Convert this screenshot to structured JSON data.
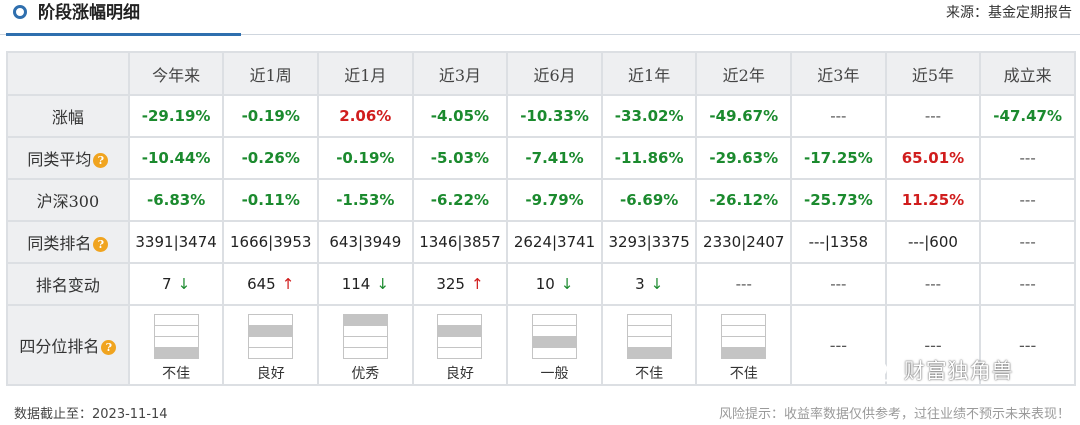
{
  "header": {
    "title": "阶段涨幅明细",
    "source": "来源：基金定期报告",
    "accent_color": "#2f6fae"
  },
  "table": {
    "columns": [
      "今年来",
      "近1周",
      "近1月",
      "近3月",
      "近6月",
      "近1年",
      "近2年",
      "近3年",
      "近5年",
      "成立来"
    ],
    "rows": [
      {
        "label": "涨幅",
        "has_help": false,
        "cells": [
          {
            "text": "-29.19%",
            "tone": "neg"
          },
          {
            "text": "-0.19%",
            "tone": "neg"
          },
          {
            "text": "2.06%",
            "tone": "pos"
          },
          {
            "text": "-4.05%",
            "tone": "neg"
          },
          {
            "text": "-10.33%",
            "tone": "neg"
          },
          {
            "text": "-33.02%",
            "tone": "neg"
          },
          {
            "text": "-49.67%",
            "tone": "neg"
          },
          {
            "text": "---",
            "tone": "dash"
          },
          {
            "text": "---",
            "tone": "dash"
          },
          {
            "text": "-47.47%",
            "tone": "neg"
          }
        ]
      },
      {
        "label": "同类平均",
        "has_help": true,
        "cells": [
          {
            "text": "-10.44%",
            "tone": "neg"
          },
          {
            "text": "-0.26%",
            "tone": "neg"
          },
          {
            "text": "-0.19%",
            "tone": "neg"
          },
          {
            "text": "-5.03%",
            "tone": "neg"
          },
          {
            "text": "-7.41%",
            "tone": "neg"
          },
          {
            "text": "-11.86%",
            "tone": "neg"
          },
          {
            "text": "-29.63%",
            "tone": "neg"
          },
          {
            "text": "-17.25%",
            "tone": "neg"
          },
          {
            "text": "65.01%",
            "tone": "pos"
          },
          {
            "text": "---",
            "tone": "dash"
          }
        ]
      },
      {
        "label": "沪深300",
        "has_help": false,
        "cells": [
          {
            "text": "-6.83%",
            "tone": "neg"
          },
          {
            "text": "-0.11%",
            "tone": "neg"
          },
          {
            "text": "-1.53%",
            "tone": "neg"
          },
          {
            "text": "-6.22%",
            "tone": "neg"
          },
          {
            "text": "-9.79%",
            "tone": "neg"
          },
          {
            "text": "-6.69%",
            "tone": "neg"
          },
          {
            "text": "-26.12%",
            "tone": "neg"
          },
          {
            "text": "-25.73%",
            "tone": "neg"
          },
          {
            "text": "11.25%",
            "tone": "pos"
          },
          {
            "text": "---",
            "tone": "dash"
          }
        ]
      },
      {
        "label": "同类排名",
        "has_help": true,
        "cells": [
          {
            "text": "3391|3474",
            "tone": "plain"
          },
          {
            "text": "1666|3953",
            "tone": "plain"
          },
          {
            "text": "643|3949",
            "tone": "plain"
          },
          {
            "text": "1346|3857",
            "tone": "plain"
          },
          {
            "text": "2624|3741",
            "tone": "plain"
          },
          {
            "text": "3293|3375",
            "tone": "plain"
          },
          {
            "text": "2330|2407",
            "tone": "plain"
          },
          {
            "text": "---|1358",
            "tone": "plain"
          },
          {
            "text": "---|600",
            "tone": "plain"
          },
          {
            "text": "---",
            "tone": "dash"
          }
        ]
      },
      {
        "label": "排名变动",
        "has_help": false,
        "cells": [
          {
            "text": "7",
            "dir": "down"
          },
          {
            "text": "645",
            "dir": "up"
          },
          {
            "text": "114",
            "dir": "down"
          },
          {
            "text": "325",
            "dir": "up"
          },
          {
            "text": "10",
            "dir": "down"
          },
          {
            "text": "3",
            "dir": "down"
          },
          {
            "text": "---",
            "dir": "none"
          },
          {
            "text": "---",
            "dir": "none"
          },
          {
            "text": "---",
            "dir": "none"
          },
          {
            "text": "---",
            "dir": "none"
          }
        ]
      }
    ],
    "quartile_row": {
      "label": "四分位排名",
      "has_help": true,
      "cells": [
        {
          "label": "不佳",
          "quartile": 4
        },
        {
          "label": "良好",
          "quartile": 2
        },
        {
          "label": "优秀",
          "quartile": 1
        },
        {
          "label": "良好",
          "quartile": 2
        },
        {
          "label": "一般",
          "quartile": 3
        },
        {
          "label": "不佳",
          "quartile": 4
        },
        {
          "label": "不佳",
          "quartile": 4
        },
        {
          "label": "---",
          "quartile": 0
        },
        {
          "label": "---",
          "quartile": 0
        },
        {
          "label": "---",
          "quartile": 0
        }
      ]
    },
    "help_icon": "question-circle-icon",
    "colors": {
      "negative": "#1b8a2e",
      "positive": "#d01d1d",
      "quartile_fill": "#c4c4c4"
    }
  },
  "footer": {
    "date": "数据截止至：2023-11-14",
    "risk": "风险提示：收益率数据仅供参考，过往业绩不预示未来表现！"
  },
  "watermark": {
    "text": "财富独角兽",
    "icon": "wechat-icon"
  }
}
